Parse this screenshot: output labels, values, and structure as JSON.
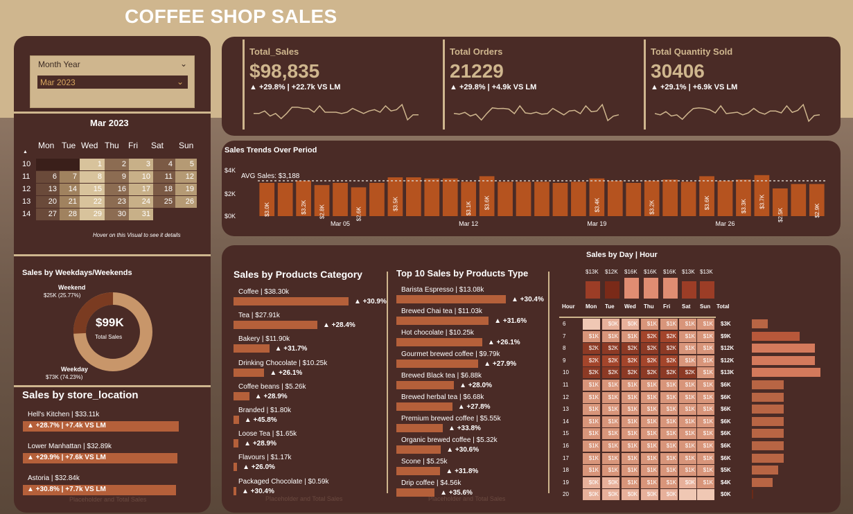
{
  "title": "COFFEE SHOP SALES",
  "slicer": {
    "label": "Month Year",
    "value": "Mar 2023"
  },
  "calendar": {
    "title": "Mar 2023",
    "days": [
      "Mon",
      "Tue",
      "Wed",
      "Thu",
      "Fri",
      "Sat",
      "Sun"
    ],
    "weeks": [
      "10",
      "11",
      "12",
      "13",
      "14"
    ],
    "cells": [
      [
        "",
        "",
        "1",
        "2",
        "3",
        "4",
        "5"
      ],
      [
        "6",
        "7",
        "8",
        "9",
        "10",
        "11",
        "12"
      ],
      [
        "13",
        "14",
        "15",
        "16",
        "17",
        "18",
        "19"
      ],
      [
        "20",
        "21",
        "22",
        "23",
        "24",
        "25",
        "26"
      ],
      [
        "27",
        "28",
        "29",
        "30",
        "31",
        "",
        ""
      ]
    ],
    "note": "Hover on this Visual to see it details"
  },
  "weekday_weekend": {
    "title": "Sales by Weekdays/Weekends",
    "weekend_label": "Weekend",
    "weekend_value": "$25K (25.77%)",
    "weekday_label": "Weekday",
    "weekday_value": "$73K (74.23%)",
    "center_value": "$99K",
    "center_label": "Total Sales",
    "weekend_pct": 25.77
  },
  "store_location": {
    "title": "Sales by store_location",
    "items": [
      {
        "label": "Hell's Kitchen | $33.11k",
        "delta": "▲ +28.7% | +7.4k VS LM"
      },
      {
        "label": "Lower Manhattan | $32.89k",
        "delta": "▲ +29.9% | +7.6k VS LM"
      },
      {
        "label": "Astoria | $32.84k",
        "delta": "▲ +30.8% | +7.7k VS LM"
      }
    ],
    "placeholder": "Placeholder and Total Sales"
  },
  "kpis": [
    {
      "label": "Total_Sales",
      "value": "$98,835",
      "delta": "▲ +29.8% | +22.7k VS LM"
    },
    {
      "label": "Total Orders",
      "value": "21229",
      "delta": "▲ +29.8% | +4.9k VS LM"
    },
    {
      "label": "Total Quantity Sold",
      "value": "30406",
      "delta": "▲ +29.1% | +6.9k VS LM"
    }
  ],
  "trend": {
    "title": "Sales Trends Over Period",
    "avg_label": "AVG Sales: $3,188",
    "yticks": [
      "$4K",
      "$2K",
      "$0K"
    ],
    "xticks": [
      "Mar 05",
      "Mar 12",
      "Mar 19",
      "Mar 26"
    ]
  },
  "chart_data": {
    "type": "bar",
    "categories": [
      "1",
      "2",
      "3",
      "4",
      "5",
      "6",
      "7",
      "8",
      "9",
      "10",
      "11",
      "12",
      "13",
      "14",
      "15",
      "16",
      "17",
      "18",
      "19",
      "20",
      "21",
      "22",
      "23",
      "24",
      "25",
      "26",
      "27",
      "28",
      "29",
      "30",
      "31"
    ],
    "values": [
      3.0,
      3.0,
      3.2,
      2.8,
      3.0,
      2.6,
      3.0,
      3.5,
      3.5,
      3.4,
      3.4,
      3.1,
      3.6,
      3.1,
      3.1,
      3.1,
      3.0,
      3.1,
      3.4,
      3.2,
      3.0,
      3.2,
      3.3,
      3.1,
      3.6,
      3.2,
      3.3,
      3.7,
      2.5,
      2.9,
      2.9
    ],
    "data_labels": [
      "$3.0K",
      "",
      "$3.2K",
      "$2.8K",
      "",
      "$2.6K",
      "",
      "$3.5K",
      "",
      "",
      "",
      "$3.1K",
      "$3.6K",
      "",
      "",
      "",
      "",
      "",
      "$3.4K",
      "",
      "",
      "$3.2K",
      "",
      "",
      "$3.6K",
      "",
      "$3.3K",
      "$3.7K",
      "$2.5K",
      "",
      "$2.9K"
    ],
    "ylabel": "",
    "ylim": [
      0,
      4
    ],
    "avg": 3.188
  },
  "category": {
    "title": "Sales by Products Category",
    "items": [
      {
        "label": "Coffee | $38.30k",
        "delta": "▲ +30.9%",
        "value": 38.3
      },
      {
        "label": "Tea | $27.91k",
        "delta": "▲ +28.4%",
        "value": 27.91
      },
      {
        "label": "Bakery | $11.90k",
        "delta": "▲ +31.7%",
        "value": 11.9
      },
      {
        "label": "Drinking Chocolate | $10.25k",
        "delta": "▲ +26.1%",
        "value": 10.25
      },
      {
        "label": "Coffee beans | $5.26k",
        "delta": "▲ +28.9%",
        "value": 5.26
      },
      {
        "label": "Branded | $1.80k",
        "delta": "▲ +45.8%",
        "value": 1.8
      },
      {
        "label": "Loose Tea | $1.65k",
        "delta": "▲ +28.9%",
        "value": 1.65
      },
      {
        "label": "Flavours | $1.17k",
        "delta": "▲ +26.0%",
        "value": 1.17
      },
      {
        "label": "Packaged Chocolate | $0.59k",
        "delta": "▲ +30.4%",
        "value": 0.59
      }
    ],
    "placeholder": "Placeholder and Total Sales"
  },
  "product_type": {
    "title": "Top 10 Sales by Products Type",
    "items": [
      {
        "label": "Barista Espresso | $13.08k",
        "delta": "▲ +30.4%",
        "value": 13.08
      },
      {
        "label": "Brewed Chai tea | $11.03k",
        "delta": "▲ +31.6%",
        "value": 11.03
      },
      {
        "label": "Hot chocolate | $10.25k",
        "delta": "▲ +26.1%",
        "value": 10.25
      },
      {
        "label": "Gourmet brewed coffee | $9.79k",
        "delta": "▲ +27.9%",
        "value": 9.79
      },
      {
        "label": "Brewed Black tea | $6.88k",
        "delta": "▲ +28.0%",
        "value": 6.88
      },
      {
        "label": "Brewed herbal tea | $6.68k",
        "delta": "▲ +27.8%",
        "value": 6.68
      },
      {
        "label": "Premium brewed coffee | $5.55k",
        "delta": "▲ +33.8%",
        "value": 5.55
      },
      {
        "label": "Organic brewed coffee | $5.32k",
        "delta": "▲ +30.6%",
        "value": 5.32
      },
      {
        "label": "Scone | $5.25k",
        "delta": "▲ +31.8%",
        "value": 5.25
      },
      {
        "label": "Drip coffee | $4.56k",
        "delta": "▲ +35.6%",
        "value": 4.56
      }
    ],
    "placeholder": "Placeholder and Total Sales"
  },
  "heatmap": {
    "title": "Sales by Day | Hour",
    "day_totals": [
      "$13K",
      "$12K",
      "$16K",
      "$16K",
      "$16K",
      "$13K",
      "$13K"
    ],
    "day_total_values": [
      13,
      12,
      16,
      16,
      16,
      13,
      13
    ],
    "hour_header": "Hour",
    "total_header": "Total",
    "days": [
      "Mon",
      "Tue",
      "Wed",
      "Thu",
      "Fri",
      "Sat",
      "Sun"
    ],
    "hours": [
      "6",
      "7",
      "8",
      "9",
      "10",
      "11",
      "12",
      "13",
      "14",
      "15",
      "16",
      "17",
      "18",
      "19",
      "20"
    ],
    "rows": [
      [
        "",
        "$0K",
        "$0K",
        "$1K",
        "$1K",
        "$1K",
        "$1K"
      ],
      [
        "$1K",
        "$1K",
        "$1K",
        "$2K",
        "$2K",
        "$1K",
        "$1K"
      ],
      [
        "$2K",
        "$2K",
        "$2K",
        "$2K",
        "$2K",
        "$1K",
        "$1K"
      ],
      [
        "$2K",
        "$2K",
        "$2K",
        "$2K",
        "$2K",
        "$1K",
        "$1K"
      ],
      [
        "$2K",
        "$2K",
        "$2K",
        "$2K",
        "$2K",
        "$2K",
        "$1K"
      ],
      [
        "$1K",
        "$1K",
        "$1K",
        "$1K",
        "$1K",
        "$1K",
        "$1K"
      ],
      [
        "$1K",
        "$1K",
        "$1K",
        "$1K",
        "$1K",
        "$1K",
        "$1K"
      ],
      [
        "$1K",
        "$1K",
        "$1K",
        "$1K",
        "$1K",
        "$1K",
        "$1K"
      ],
      [
        "$1K",
        "$1K",
        "$1K",
        "$1K",
        "$1K",
        "$1K",
        "$1K"
      ],
      [
        "$1K",
        "$1K",
        "$1K",
        "$1K",
        "$1K",
        "$1K",
        "$1K"
      ],
      [
        "$1K",
        "$1K",
        "$1K",
        "$1K",
        "$1K",
        "$1K",
        "$1K"
      ],
      [
        "$1K",
        "$1K",
        "$1K",
        "$1K",
        "$1K",
        "$1K",
        "$1K"
      ],
      [
        "$1K",
        "$1K",
        "$1K",
        "$1K",
        "$1K",
        "$1K",
        "$1K"
      ],
      [
        "$0K",
        "$0K",
        "$1K",
        "$1K",
        "$1K",
        "$0K",
        "$1K"
      ],
      [
        "$0K",
        "$0K",
        "$0K",
        "$0K",
        "$0K",
        "",
        ""
      ]
    ],
    "totals": [
      "$3K",
      "$9K",
      "$12K",
      "$12K",
      "$13K",
      "$6K",
      "$6K",
      "$6K",
      "$6K",
      "$6K",
      "$6K",
      "$6K",
      "$5K",
      "$4K",
      "$0K"
    ],
    "total_values": [
      3,
      9,
      12,
      12,
      13,
      6,
      6,
      6,
      6,
      6,
      6,
      6,
      5,
      4,
      0.2
    ]
  },
  "colors": {
    "panel": "#4a2b26",
    "accent": "#cfb68e",
    "bar": "#b5603a",
    "kpi_text": "#cfb68e"
  }
}
